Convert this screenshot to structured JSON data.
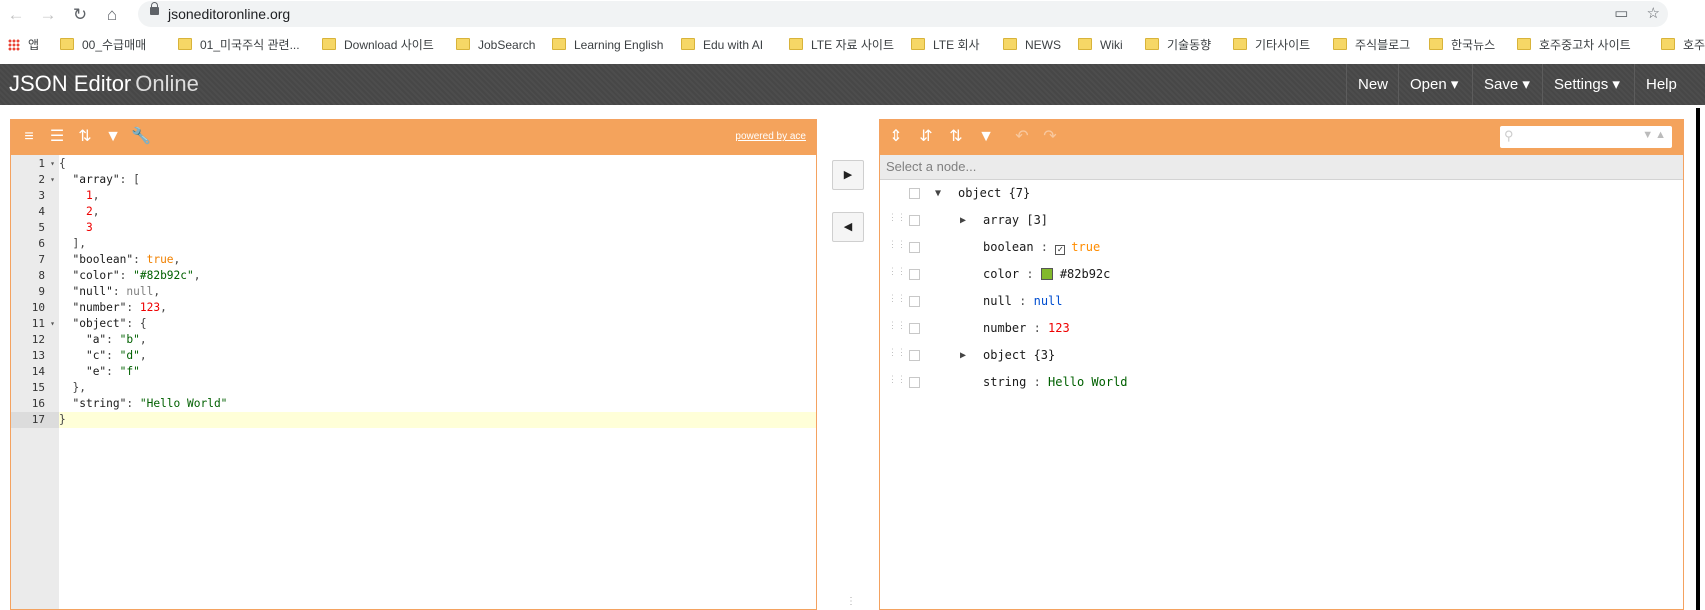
{
  "browser": {
    "url": "jsoneditoronline.org",
    "bookmarks": [
      {
        "label": "앱",
        "type": "apps"
      },
      {
        "label": "00_수급매매",
        "type": "folder"
      },
      {
        "label": "01_미국주식 관련...",
        "type": "folder"
      },
      {
        "label": "Download 사이트",
        "type": "folder"
      },
      {
        "label": "JobSearch",
        "type": "folder"
      },
      {
        "label": "Learning English",
        "type": "folder"
      },
      {
        "label": "Edu with AI",
        "type": "folder"
      },
      {
        "label": "LTE 자료 사이트",
        "type": "folder"
      },
      {
        "label": "LTE 회사",
        "type": "folder"
      },
      {
        "label": "NEWS",
        "type": "folder"
      },
      {
        "label": "Wiki",
        "type": "folder"
      },
      {
        "label": "기술동향",
        "type": "folder"
      },
      {
        "label": "기타사이트",
        "type": "folder"
      },
      {
        "label": "주식블로그",
        "type": "folder"
      },
      {
        "label": "한국뉴스",
        "type": "folder"
      },
      {
        "label": "호주중고차 사이트",
        "type": "folder"
      },
      {
        "label": "호주",
        "type": "folder"
      }
    ]
  },
  "header": {
    "title_main": "JSON Editor",
    "title_sub": "Online",
    "menu": {
      "new": "New",
      "open": "Open ▾",
      "save": "Save ▾",
      "settings": "Settings ▾",
      "help": "Help"
    }
  },
  "code_editor": {
    "powered_by": "powered by ace",
    "active_line": 17,
    "lines": [
      [
        [
          "{",
          "punc"
        ]
      ],
      [
        [
          "  ",
          ""
        ],
        [
          "\"array\"",
          "key"
        ],
        [
          ": [",
          "punc"
        ]
      ],
      [
        [
          "    ",
          ""
        ],
        [
          "1",
          "num"
        ],
        [
          ",",
          "punc"
        ]
      ],
      [
        [
          "    ",
          ""
        ],
        [
          "2",
          "num"
        ],
        [
          ",",
          "punc"
        ]
      ],
      [
        [
          "    ",
          ""
        ],
        [
          "3",
          "num"
        ]
      ],
      [
        [
          "  ],",
          "punc"
        ]
      ],
      [
        [
          "  ",
          ""
        ],
        [
          "\"boolean\"",
          "key"
        ],
        [
          ": ",
          "punc"
        ],
        [
          "true",
          "bool"
        ],
        [
          ",",
          "punc"
        ]
      ],
      [
        [
          "  ",
          ""
        ],
        [
          "\"color\"",
          "key"
        ],
        [
          ": ",
          "punc"
        ],
        [
          "\"#82b92c\"",
          "str"
        ],
        [
          ",",
          "punc"
        ]
      ],
      [
        [
          "  ",
          ""
        ],
        [
          "\"null\"",
          "key"
        ],
        [
          ": ",
          "punc"
        ],
        [
          "null",
          "null"
        ],
        [
          ",",
          "punc"
        ]
      ],
      [
        [
          "  ",
          ""
        ],
        [
          "\"number\"",
          "key"
        ],
        [
          ": ",
          "punc"
        ],
        [
          "123",
          "num"
        ],
        [
          ",",
          "punc"
        ]
      ],
      [
        [
          "  ",
          ""
        ],
        [
          "\"object\"",
          "key"
        ],
        [
          ": {",
          "punc"
        ]
      ],
      [
        [
          "    ",
          ""
        ],
        [
          "\"a\"",
          "key"
        ],
        [
          ": ",
          "punc"
        ],
        [
          "\"b\"",
          "str"
        ],
        [
          ",",
          "punc"
        ]
      ],
      [
        [
          "    ",
          ""
        ],
        [
          "\"c\"",
          "key"
        ],
        [
          ": ",
          "punc"
        ],
        [
          "\"d\"",
          "str"
        ],
        [
          ",",
          "punc"
        ]
      ],
      [
        [
          "    ",
          ""
        ],
        [
          "\"e\"",
          "key"
        ],
        [
          ": ",
          "punc"
        ],
        [
          "\"f\"",
          "str"
        ]
      ],
      [
        [
          "  },",
          "punc"
        ]
      ],
      [
        [
          "  ",
          ""
        ],
        [
          "\"string\"",
          "key"
        ],
        [
          ": ",
          "punc"
        ],
        [
          "\"Hello World\"",
          "str"
        ]
      ],
      [
        [
          "}",
          "punc"
        ]
      ]
    ],
    "fold_lines": [
      1,
      2,
      11
    ]
  },
  "tree_editor": {
    "nav_placeholder": "Select a node...",
    "rows": [
      {
        "field": "object {7}",
        "expander": "▼",
        "level": 0,
        "value": "",
        "kind": "root"
      },
      {
        "field": "array [3]",
        "expander": "▶",
        "level": 1,
        "value": "",
        "kind": "collapsed"
      },
      {
        "field": "boolean",
        "expander": "",
        "level": 1,
        "value": "true",
        "kind": "bool"
      },
      {
        "field": "color",
        "expander": "",
        "level": 1,
        "value": "#82b92c",
        "kind": "color"
      },
      {
        "field": "null",
        "expander": "",
        "level": 1,
        "value": "null",
        "kind": "null"
      },
      {
        "field": "number",
        "expander": "",
        "level": 1,
        "value": "123",
        "kind": "num"
      },
      {
        "field": "object {3}",
        "expander": "▶",
        "level": 1,
        "value": "",
        "kind": "collapsed"
      },
      {
        "field": "string",
        "expander": "",
        "level": 1,
        "value": "Hello World",
        "kind": "str"
      }
    ]
  },
  "colors": {
    "toolbar": "#f4a35c",
    "header": "#474747",
    "swatch": "#82b92c"
  }
}
